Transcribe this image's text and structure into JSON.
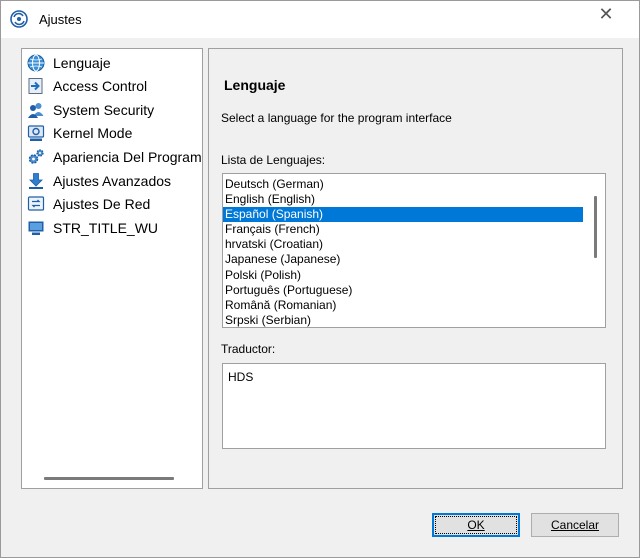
{
  "window": {
    "title": "Ajustes",
    "close_glyph": "✕"
  },
  "sidebar": {
    "items": [
      {
        "label": "Lenguaje",
        "icon": "globe-icon"
      },
      {
        "label": "Access Control",
        "icon": "access-arrow-icon"
      },
      {
        "label": "System Security",
        "icon": "users-icon"
      },
      {
        "label": "Kernel Mode",
        "icon": "kernel-icon"
      },
      {
        "label": "Apariencia Del Programa",
        "icon": "gears-icon"
      },
      {
        "label": "Ajustes Avanzados",
        "icon": "download-icon"
      },
      {
        "label": "Ajustes De Red",
        "icon": "network-icon"
      },
      {
        "label": "STR_TITLE_WU",
        "icon": "monitor-icon"
      }
    ]
  },
  "main": {
    "title": "Lenguaje",
    "description": "Select a language for the program interface",
    "list_label": "Lista de Lenguajes:",
    "languages": [
      "Deutsch (German)",
      "English (English)",
      "Español (Spanish)",
      "Français (French)",
      "hrvatski (Croatian)",
      "Japanese (Japanese)",
      "Polski (Polish)",
      "Português (Portuguese)",
      "Română (Romanian)",
      "Srpski (Serbian)"
    ],
    "selected_language": "Español (Spanish)",
    "translator_label": "Traductor:",
    "translator_value": "HDS"
  },
  "buttons": {
    "ok": "OK",
    "cancel": "Cancelar"
  },
  "colors": {
    "selection": "#0078d7",
    "dialog_bg": "#f0f0f0",
    "accent": "#0078d7"
  }
}
